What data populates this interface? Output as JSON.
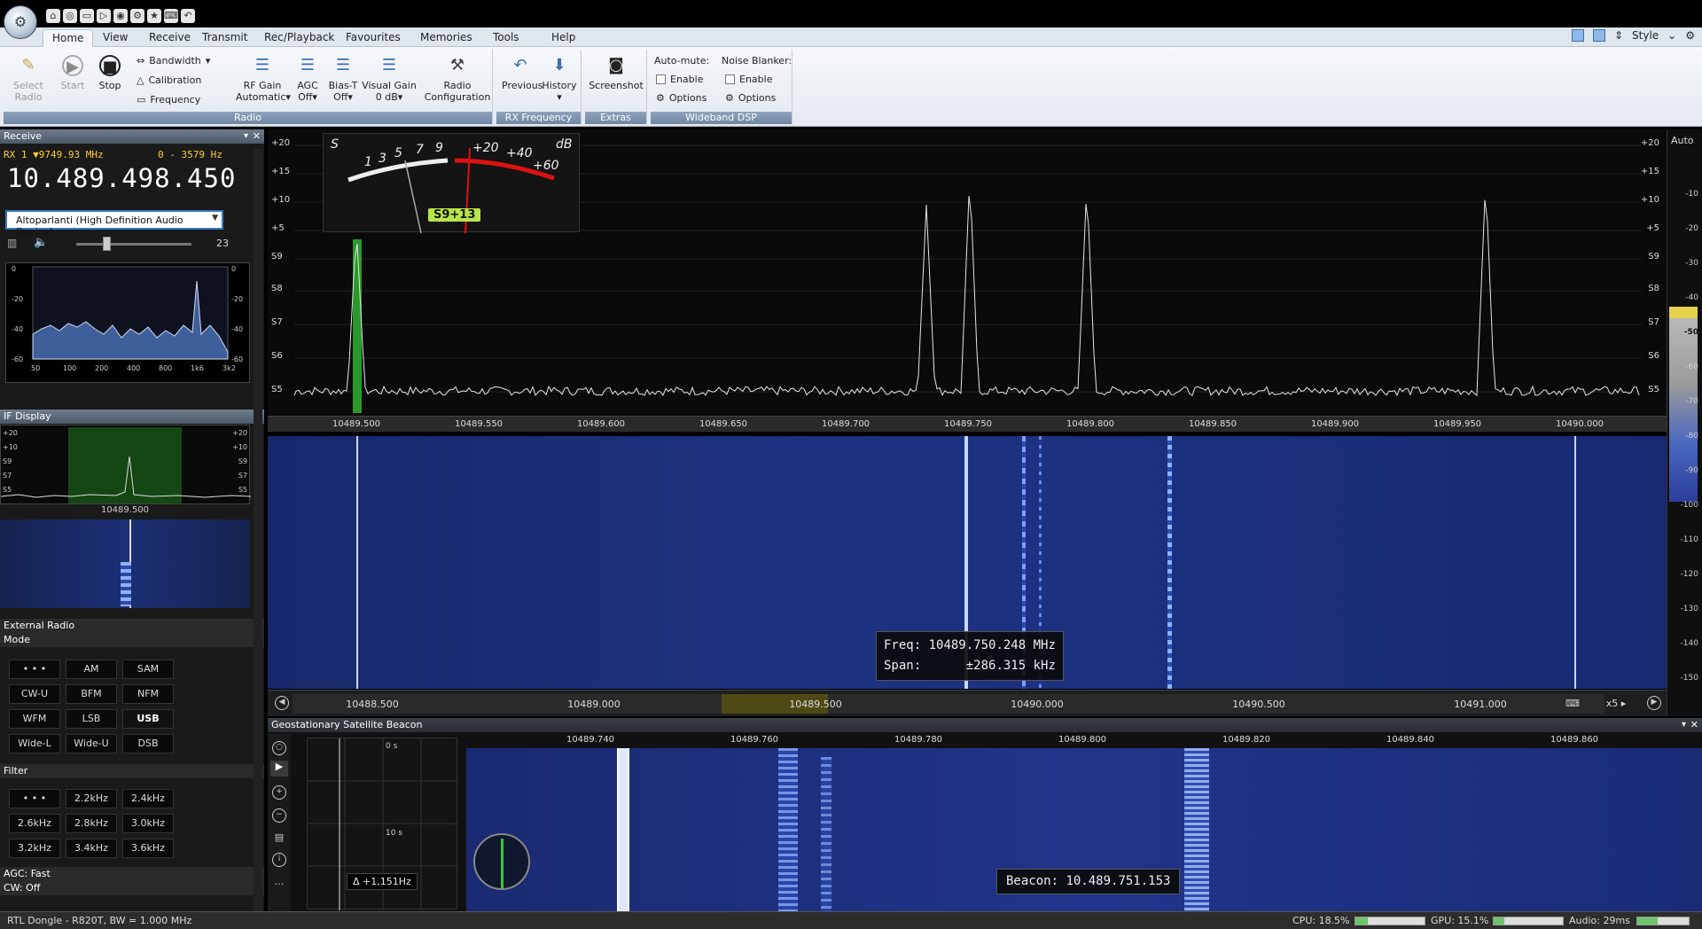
{
  "quick_access": [
    "⌂",
    "◎",
    "▭",
    "▷",
    "◉",
    "⚙",
    "★",
    "⌨",
    "↶"
  ],
  "tabs": [
    "Home",
    "View",
    "Receive",
    "Transmit",
    "Rec/Playback",
    "Favourites",
    "Memories",
    "Tools",
    "Help"
  ],
  "active_tab": "Home",
  "style_label": "Style",
  "ribbon": {
    "radio": {
      "label": "Radio",
      "select_radio": "Select Radio",
      "start": "Start",
      "stop": "Stop",
      "bandwidth": "Bandwidth",
      "calibration": "Calibration",
      "frequency": "Frequency",
      "rf_gain": "RF Gain",
      "rf_gain_val": "Automatic",
      "agc": "AGC",
      "agc_val": "Off",
      "bias_t": "Bias-T",
      "bias_t_val": "Off",
      "visual_gain": "Visual Gain",
      "visual_gain_val": "0 dB",
      "radio_config": "Radio Configuration"
    },
    "rx_frequency": {
      "label": "RX Frequency",
      "previous": "Previous",
      "history": "History"
    },
    "extras": {
      "label": "Extras",
      "screenshot": "Screenshot"
    },
    "wideband": {
      "label": "Wideband DSP",
      "auto_mute": "Auto-mute:",
      "noise_blanker": "Noise Blanker:",
      "enable": "Enable",
      "options": "Options"
    }
  },
  "receive": {
    "title": "Receive",
    "rx_line": "RX 1 ▼9749.93 MHz",
    "hz_range": "0 - 3579 Hz",
    "frequency": "10.489.498.450",
    "audio_device": "Altoparlanti (High Definition Audio Device)",
    "volume": "23",
    "audio_axis_y": [
      "0",
      "-20",
      "-40",
      "-60"
    ],
    "audio_axis_x": [
      "50",
      "100",
      "200",
      "400",
      "800",
      "1k6",
      "3k2"
    ]
  },
  "if_display": {
    "title": "IF Display",
    "scale": [
      "+20",
      "+10",
      "S9",
      "S7",
      "S5"
    ],
    "freq_label": "10489.500"
  },
  "external_radio": "External Radio",
  "mode": {
    "title": "Mode",
    "buttons": [
      "• • •",
      "AM",
      "SAM",
      "CW-U",
      "BFM",
      "NFM",
      "WFM",
      "LSB",
      "USB",
      "Wide-L",
      "Wide-U",
      "DSB"
    ],
    "selected": "USB"
  },
  "filter": {
    "title": "Filter",
    "buttons": [
      "• • •",
      "2.2kHz",
      "2.4kHz",
      "2.6kHz",
      "2.8kHz",
      "3.0kHz",
      "3.2kHz",
      "3.4kHz",
      "3.6kHz"
    ]
  },
  "agc_label": "AGC: Fast",
  "cw_label": "CW: Off",
  "spectrum": {
    "left_scale": [
      "+20",
      "+15",
      "+10",
      "+5",
      "S9",
      "S8",
      "S7",
      "S6",
      "S5"
    ],
    "right_scale": [
      "+20",
      "+15",
      "+10",
      "+5",
      "S9",
      "S8",
      "S7",
      "S6",
      "S5"
    ],
    "axis_labels": [
      "10489.500",
      "10489.550",
      "10489.600",
      "10489.650",
      "10489.700",
      "10489.750",
      "10489.800",
      "10489.850",
      "10489.900",
      "10489.950",
      "10490.000"
    ],
    "smeter_ticks": [
      "S",
      "1",
      "3",
      "5",
      "7",
      "9",
      "+20",
      "+40",
      "+60",
      "dB"
    ],
    "smeter_reading": "S9+13"
  },
  "waterfall_tooltip": {
    "freq_label": "Freq:",
    "freq_value": "10489.750.248 MHz",
    "span_label": "Span:",
    "span_value": "±286.315 kHz"
  },
  "overview_axis": [
    "10488.500",
    "10489.000",
    "10489.500",
    "10490.000",
    "10490.500",
    "10491.000"
  ],
  "zoom": "x5",
  "right_scale": {
    "auto": "Auto",
    "ticks": [
      "-10",
      "-20",
      "-30",
      "-40",
      "-50",
      "-60",
      "-70",
      "-80",
      "-90",
      "-100",
      "-110",
      "-120",
      "-130",
      "-140",
      "-150"
    ],
    "highlight": "-50"
  },
  "beacon": {
    "title": "Geostationary Satellite Beacon",
    "axis": [
      "10489.740",
      "10489.760",
      "10489.780",
      "10489.800",
      "10489.820",
      "10489.840",
      "10489.860"
    ],
    "time_top": "0 s",
    "time_mid": "10 s",
    "delta": "Δ +1,151Hz",
    "beacon_label": "Beacon:",
    "beacon_value": "10.489.751.153"
  },
  "status": {
    "device": "RTL Dongle - R820T, BW = 1.000 MHz",
    "cpu": "CPU: 18.5%",
    "gpu": "GPU: 15.1%",
    "audio": "Audio: 29ms",
    "cpu_pct": 18.5,
    "gpu_pct": 15.1
  }
}
